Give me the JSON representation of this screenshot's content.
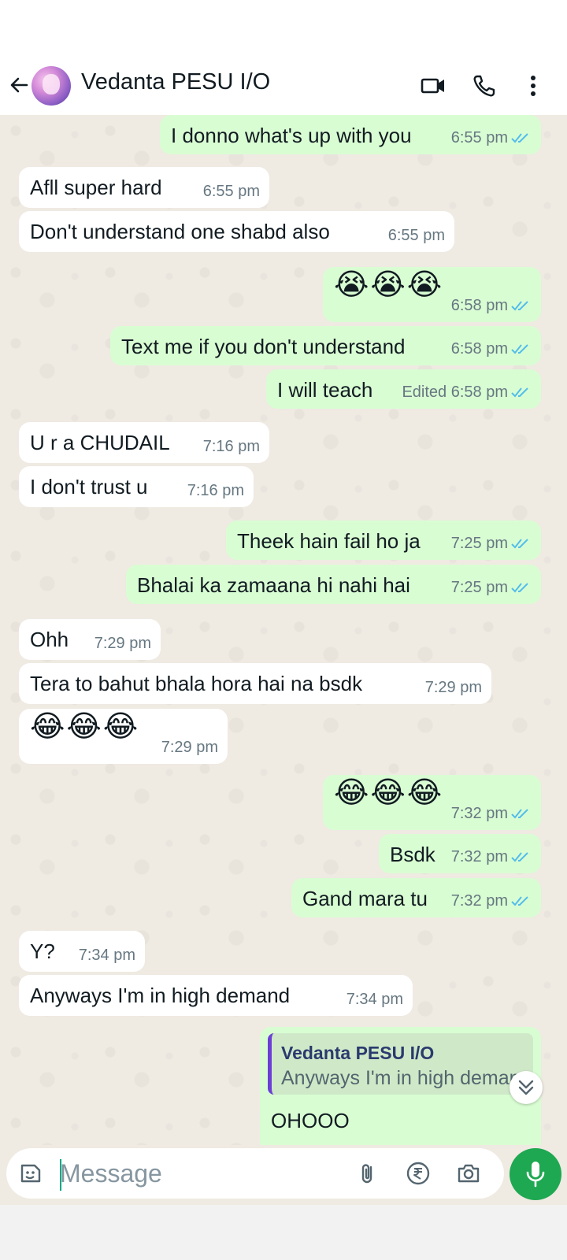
{
  "header": {
    "title": "Vedanta PESU I/O",
    "icons": [
      "back-arrow-icon",
      "video-call-icon",
      "voice-call-icon",
      "more-options-icon"
    ]
  },
  "messages": [
    {
      "dir": "out",
      "text": "I donno what's up with you",
      "time": "6:55 pm",
      "read": true
    },
    {
      "dir": "in",
      "text": "Afll super hard",
      "time": "6:55 pm"
    },
    {
      "dir": "in",
      "text": "Don't understand one shabd also",
      "time": "6:55 pm"
    },
    {
      "dir": "out",
      "text": "😭😭😭",
      "time": "6:58 pm",
      "read": true
    },
    {
      "dir": "out",
      "text": "Text me if you don't understand",
      "time": "6:58 pm",
      "read": true
    },
    {
      "dir": "out",
      "text": "I will teach",
      "time": "Edited 6:58 pm",
      "read": true
    },
    {
      "dir": "in",
      "text": "U r a CHUDAIL",
      "time": "7:16 pm"
    },
    {
      "dir": "in",
      "text": "I don't trust u",
      "time": "7:16 pm"
    },
    {
      "dir": "out",
      "text": "Theek hain fail ho ja",
      "time": "7:25 pm",
      "read": true
    },
    {
      "dir": "out",
      "text": "Bhalai ka zamaana hi nahi hai",
      "time": "7:25 pm",
      "read": true
    },
    {
      "dir": "in",
      "text": "Ohh",
      "time": "7:29 pm"
    },
    {
      "dir": "in",
      "text": "Tera to bahut bhala hora hai na bsdk",
      "time": "7:29 pm"
    },
    {
      "dir": "in",
      "text": "😂😂😂",
      "time": "7:29 pm"
    },
    {
      "dir": "out",
      "text": "😂😂😂",
      "time": "7:32 pm",
      "read": true
    },
    {
      "dir": "out",
      "text": "Bsdk",
      "time": "7:32 pm",
      "read": true
    },
    {
      "dir": "out",
      "text": "Gand mara tu",
      "time": "7:32 pm",
      "read": true
    },
    {
      "dir": "in",
      "text": "Y?",
      "time": "7:34 pm"
    },
    {
      "dir": "in",
      "text": "Anyways I'm in high demand",
      "time": "7:34 pm"
    },
    {
      "dir": "out",
      "text": "OHOOO",
      "time": "",
      "read": true,
      "reply": {
        "name": "Vedanta PESU I/O",
        "text": "Anyways I'm in high demand"
      }
    }
  ],
  "composer": {
    "placeholder": "Message",
    "icons": [
      "emoji-sticker-icon",
      "attach-icon",
      "payment-rupee-icon",
      "camera-icon",
      "mic-icon"
    ]
  },
  "colors": {
    "chat_bg": "#efeae2",
    "incoming": "#ffffff",
    "outgoing": "#d9fdd3",
    "read_ticks": "#53bdeb",
    "accent": "#1da851"
  }
}
